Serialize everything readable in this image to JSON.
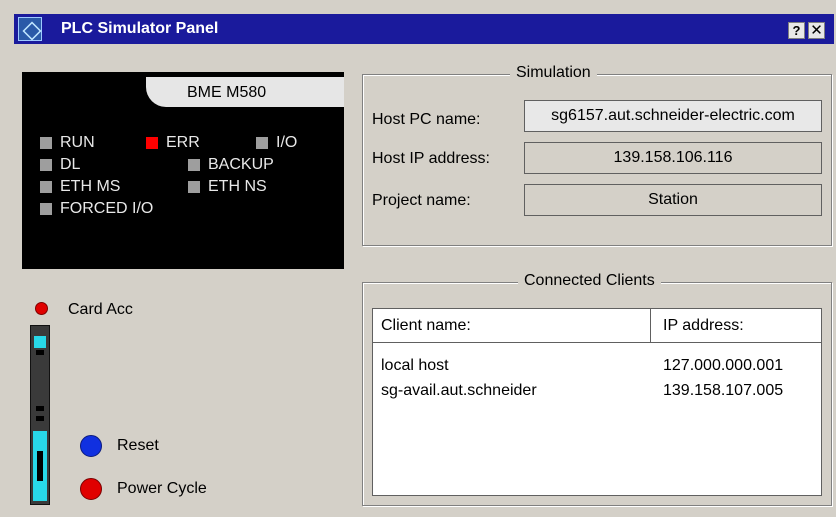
{
  "window": {
    "title": "PLC Simulator Panel",
    "help_label": "?",
    "close_label": "✕"
  },
  "plc": {
    "model": "BME M580",
    "leds": [
      {
        "label": "RUN",
        "color": "#9e9e9e"
      },
      {
        "label": "ERR",
        "color": "#ff0000"
      },
      {
        "label": "I/O",
        "color": "#9e9e9e"
      },
      {
        "label": "DL",
        "color": "#9e9e9e"
      },
      {
        "label": "BACKUP",
        "color": "#9e9e9e"
      },
      {
        "label": "ETH MS",
        "color": "#9e9e9e"
      },
      {
        "label": "ETH NS",
        "color": "#9e9e9e"
      },
      {
        "label": "FORCED I/O",
        "color": "#9e9e9e"
      }
    ]
  },
  "card_acc": {
    "label": "Card Acc",
    "color": "#e00000"
  },
  "buttons": {
    "reset_label": "Reset",
    "power_cycle_label": "Power Cycle"
  },
  "simulation": {
    "title": "Simulation",
    "host_pc_label": "Host PC name:",
    "host_pc_value": "sg6157.aut.schneider-electric.com",
    "host_ip_label": "Host IP address:",
    "host_ip_value": "139.158.106.116",
    "project_label": "Project name:",
    "project_value": "Station"
  },
  "clients": {
    "title": "Connected Clients",
    "columns": [
      "Client name:",
      "IP address:"
    ],
    "rows": [
      {
        "name": "local host",
        "ip": "127.000.000.001"
      },
      {
        "name": "sg-avail.aut.schneider",
        "ip": "139.158.107.005"
      }
    ]
  }
}
